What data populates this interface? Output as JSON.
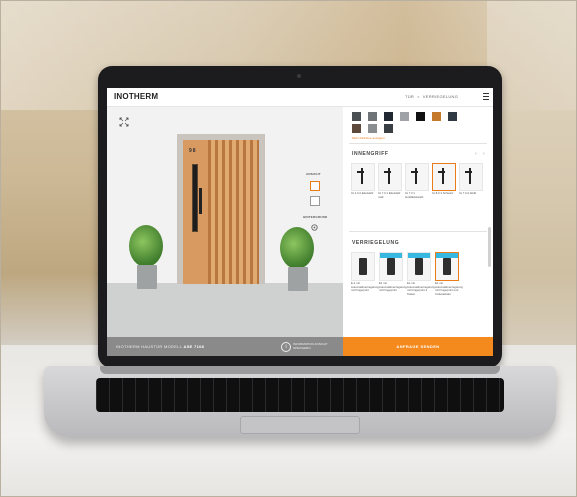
{
  "app": {
    "logo": "INOTHERM",
    "breadcrumbs": [
      "TÜR",
      ">",
      "VERRIEGELUNG"
    ]
  },
  "preview": {
    "door_number": "98",
    "side_controls": {
      "label_ansicht": "ANSICHT",
      "label_hintergrund": "HINTERGRUND"
    }
  },
  "bottombar": {
    "model_prefix": "INOTHERM HAUSTÜR MODELL",
    "model_name": "ASE 7108",
    "info_text": "INFORMATION ANSICHT SPEICHERN"
  },
  "cta": {
    "label": "ANFRAGE SENDEN"
  },
  "colors": {
    "accent": "#F48A1E",
    "swatches": [
      "#4a4f54",
      "#6e7378",
      "#222831",
      "#9fa3a7",
      "#111111",
      "#c47a2a",
      "#2f3a45",
      "#5d4a3c",
      "#8a8d90",
      "#3a3f44"
    ]
  },
  "panel": {
    "swatch_link": "Mehr Farbtöne anzeigen",
    "handles_title": "INNENGRIFF",
    "handles": [
      {
        "label": "Ini 1.0 A Edelstahl"
      },
      {
        "label": "Ini 7.0 1 Edelstahl matt"
      },
      {
        "label": "Ini 7.0 1 Gold/Edelstahl"
      },
      {
        "label": "Ini 8.0 4 Schwarz",
        "selected": true
      },
      {
        "label": "Ini 7.0 A Weiß"
      }
    ],
    "lock_title": "VERRIEGELUNG",
    "locks": [
      {
        "label": "E-1 mit Automatikverriegelung mit Fingerprint"
      },
      {
        "label": "E1 mit Automatikverriegelung mit Fingerprint"
      },
      {
        "label": "E1 mit Automatikverriegelung mit Fingerprint 2 Tasten"
      },
      {
        "label": "E1 mit Automatikverriegelung mit Fingerprint und Codetastatur",
        "selected": true
      }
    ]
  }
}
